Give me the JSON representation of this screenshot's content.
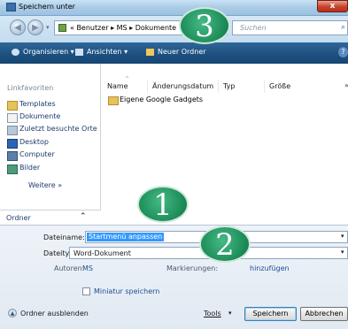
{
  "window": {
    "title": "Speichern unter",
    "close_label": "x"
  },
  "address": {
    "breadcrumb": "« Benutzer ▸ MS ▸ Dokumente",
    "search_placeholder": "Suchen"
  },
  "toolbar": {
    "organize": "Organisieren ▾",
    "views": "Ansichten ▾",
    "new_folder": "Neuer Ordner"
  },
  "sidebar": {
    "heading": "Linkfavoriten",
    "items": [
      {
        "label": "Templates",
        "icon": "folder-icon"
      },
      {
        "label": "Dokumente",
        "icon": "documents-icon"
      },
      {
        "label": "Zuletzt besuchte Orte",
        "icon": "recent-places-icon"
      },
      {
        "label": "Desktop",
        "icon": "desktop-icon"
      },
      {
        "label": "Computer",
        "icon": "computer-icon"
      },
      {
        "label": "Bilder",
        "icon": "pictures-icon"
      }
    ],
    "more": "Weitere »",
    "folders": "Ordner"
  },
  "filelist": {
    "columns": [
      "Name",
      "Änderungsdatum",
      "Typ",
      "Größe"
    ],
    "rows": [
      {
        "name": "Eigene Google Gadgets"
      }
    ]
  },
  "form": {
    "filename_label": "Dateiname:",
    "filename_value": "Startmenü anpassen",
    "filetype_label": "Dateityp:",
    "filetype_value": "Word-Dokument",
    "authors_label": "Autoren:",
    "authors_value": "MS",
    "tags_label": "Markierungen:",
    "tags_add": "hinzufügen",
    "thumbnail_label": "Miniatur speichern"
  },
  "footer": {
    "hide_folders": "Ordner ausblenden",
    "tools": "Tools",
    "save": "Speichern",
    "cancel": "Abbrechen"
  },
  "callouts": [
    "1",
    "2",
    "3"
  ],
  "colors": {
    "accent": "#1c4f7e",
    "callout": "#1b8a57",
    "selection": "#3399ff"
  }
}
